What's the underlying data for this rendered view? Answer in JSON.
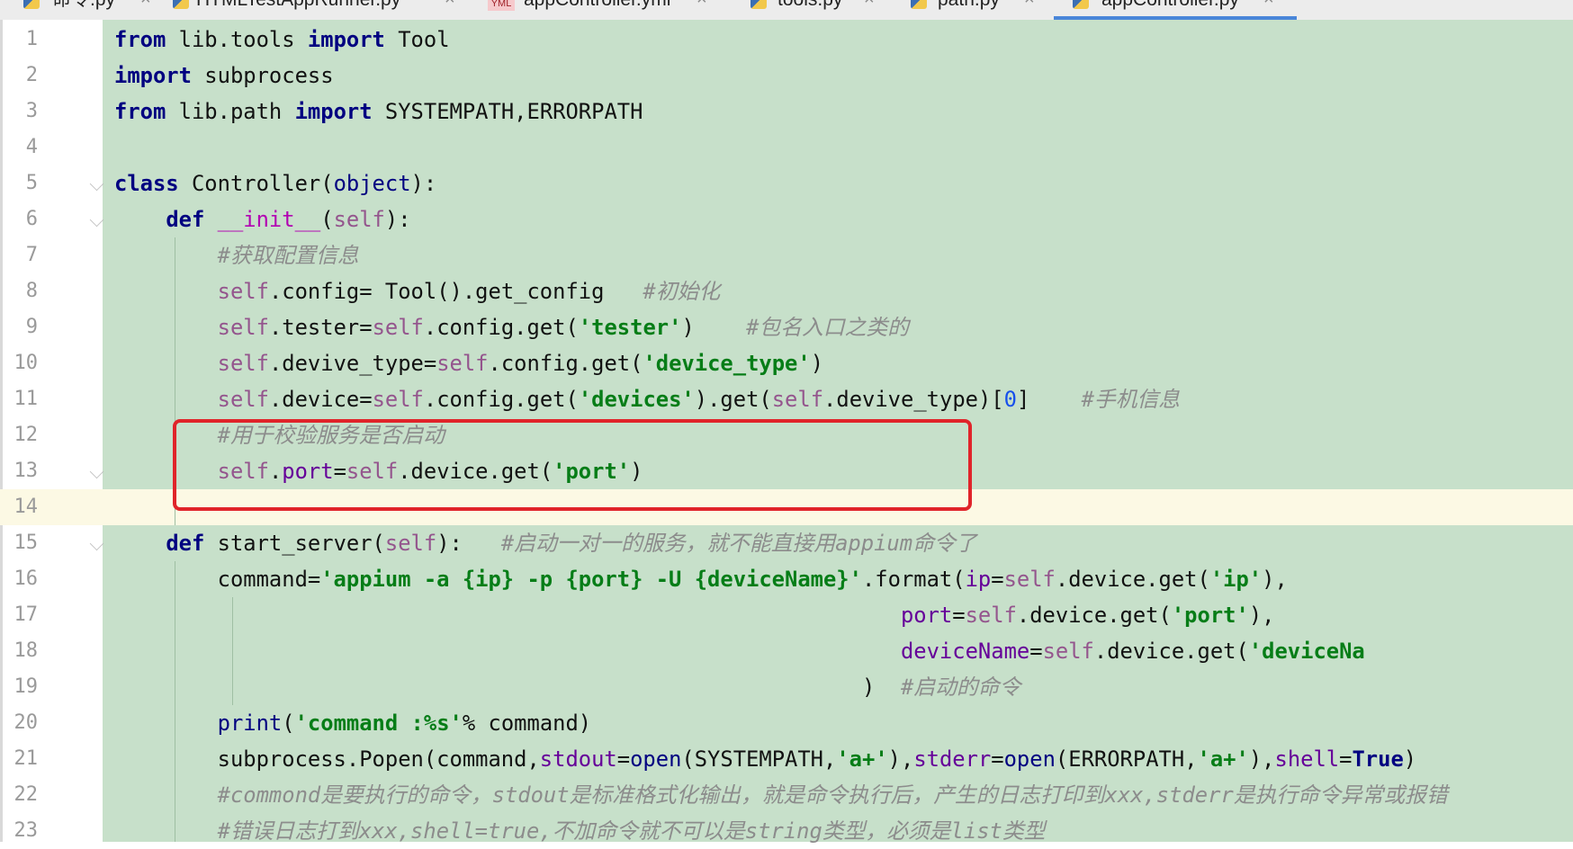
{
  "tabs": [
    {
      "label": "命令.py",
      "icon": "python-file-icon"
    },
    {
      "label": "HTMLTestAppRunner.py",
      "icon": "python-file-icon"
    },
    {
      "label": "appController.yml",
      "icon": "yml-file-icon"
    },
    {
      "label": "tools.py",
      "icon": "python-file-icon"
    },
    {
      "label": "path.py",
      "icon": "python-file-icon"
    },
    {
      "label": "appController.py",
      "icon": "python-file-icon",
      "active": true
    }
  ],
  "tab_close_glyph": "×",
  "yml_badge": "YML",
  "editor": {
    "current_line": 14,
    "highlight_box_lines": [
      12,
      13,
      14
    ],
    "lines": [
      {
        "n": "1",
        "text": "from lib.tools import Tool"
      },
      {
        "n": "2",
        "text": "import subprocess"
      },
      {
        "n": "3",
        "text": "from lib.path import SYSTEMPATH,ERRORPATH"
      },
      {
        "n": "4",
        "text": ""
      },
      {
        "n": "5",
        "text": "class Controller(object):"
      },
      {
        "n": "6",
        "text": "    def __init__(self):"
      },
      {
        "n": "7",
        "text": "        #获取配置信息"
      },
      {
        "n": "8",
        "text": "        self.config= Tool().get_config   #初始化"
      },
      {
        "n": "9",
        "text": "        self.tester=self.config.get('tester')    #包名入口之类的"
      },
      {
        "n": "10",
        "text": "        self.devive_type=self.config.get('device_type')"
      },
      {
        "n": "11",
        "text": "        self.device=self.config.get('devices').get(self.devive_type)[0]    #手机信息"
      },
      {
        "n": "12",
        "text": "        #用于校验服务是否启动"
      },
      {
        "n": "13",
        "text": "        self.port=self.device.get('port')"
      },
      {
        "n": "14",
        "text": ""
      },
      {
        "n": "15",
        "text": "    def start_server(self):   #启动一对一的服务，就不能直接用appium命令了"
      },
      {
        "n": "16",
        "text": "        command='appium -a {ip} -p {port} -U {deviceName}'.format(ip=self.device.get('ip'),"
      },
      {
        "n": "17",
        "text": "                                                             port=self.device.get('port'),"
      },
      {
        "n": "18",
        "text": "                                                             deviceName=self.device.get('deviceNa"
      },
      {
        "n": "19",
        "text": "                                                          )  #启动的命令"
      },
      {
        "n": "20",
        "text": "        print('command :%s'% command)"
      },
      {
        "n": "21",
        "text": "        subprocess.Popen(command,stdout=open(SYSTEMPATH,'a+'),stderr=open(ERRORPATH,'a+'),shell=True)"
      },
      {
        "n": "22",
        "text": "        #commond是要执行的命令，stdout是标准格式化输出，就是命令执行后，产生的日志打印到xxx,stderr是执行命令异常或报错"
      },
      {
        "n": "23",
        "text": "        #错误日志打到xxx,shell=true,不加命令就不可以是string类型，必须是list类型"
      }
    ]
  },
  "colors": {
    "code_background": "#c7e0ca",
    "current_line": "#fcf9e4",
    "keyword": "#000080",
    "self": "#94558d",
    "string": "#067d17",
    "comment": "#8c8c8c",
    "highlight_box": "#e0242a",
    "active_tab_underline": "#4a86d9"
  }
}
